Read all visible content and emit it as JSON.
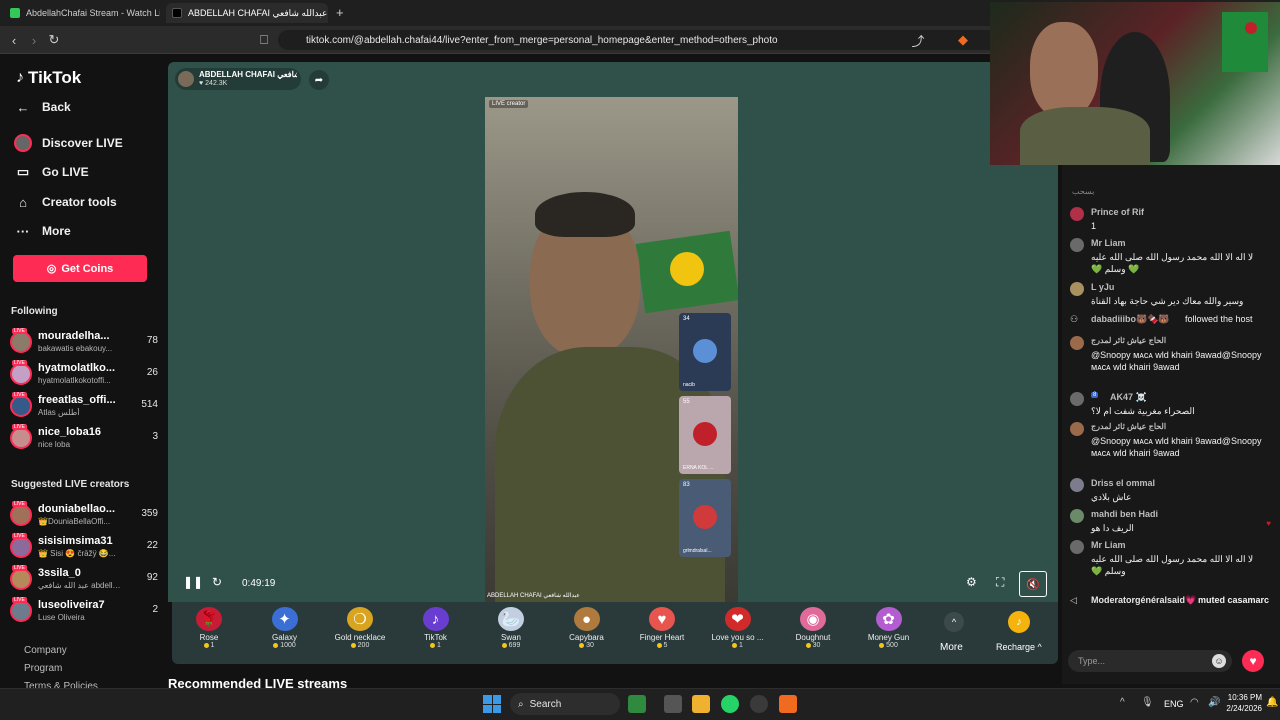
{
  "browser": {
    "tabs": [
      {
        "title": "AbdellahChafai Stream - Watch Live o"
      },
      {
        "title": "ABDELLAH CHAFAI عبدالله شافعي"
      }
    ],
    "new_tab": "+",
    "url": "tiktok.com/@abdellah.chafai44/live?enter_from_merge=personal_homepage&enter_method=others_photo"
  },
  "sidebar": {
    "logo": "TikTok",
    "back": "Back",
    "nav": [
      {
        "label": "Discover LIVE",
        "icon": "avatar-icon"
      },
      {
        "label": "Go LIVE",
        "icon": "camera-icon"
      },
      {
        "label": "Creator tools",
        "icon": "home-icon"
      },
      {
        "label": "More",
        "icon": "dots-icon"
      }
    ],
    "get_coins": "Get Coins",
    "following_title": "Following",
    "following": [
      {
        "name": "mouradelha...",
        "sub": "bakawatis ebakouy...",
        "count": "78"
      },
      {
        "name": "hyatmolatlko...",
        "sub": "hyatmolatlkokotoffi...",
        "count": "26"
      },
      {
        "name": "freeatlas_offi...",
        "sub": "Atlas أطلس",
        "count": "514"
      },
      {
        "name": "nice_loba16",
        "sub": "nice loba",
        "count": "3"
      }
    ],
    "suggested_title": "Suggested LIVE creators",
    "suggested": [
      {
        "name": "douniabellao...",
        "sub": "👑DouniaBellaOffi...",
        "count": "359"
      },
      {
        "name": "sisisimsima31",
        "sub": "👑 Sisi 😍 črāžÿ 😂...",
        "count": "22"
      },
      {
        "name": "3ssila_0",
        "sub": "عبد الله شافعي abdellah...",
        "count": "92"
      },
      {
        "name": "luseoliveira7",
        "sub": "Luse Oliveira",
        "count": "2"
      }
    ],
    "footer": [
      "Company",
      "Program",
      "Terms & Policies"
    ],
    "live_tag": "LIVE"
  },
  "stream": {
    "host_name": "ABDELLAH CHAFAI عبدالله شافعي",
    "host_likes": "242.3K",
    "feed_tag": "LIVE creator",
    "watermark": "ABDELLAH CHAFAI عبدالله شافعي",
    "elapsed": "0:49:19",
    "guests": [
      {
        "num": "34",
        "name": "nacib"
      },
      {
        "num": "55",
        "name": "ERNA KOL ..."
      },
      {
        "num": "83",
        "name": "grlmdralsal..."
      }
    ]
  },
  "gifts": [
    {
      "name": "Rose",
      "price": "1",
      "icon": "🌹",
      "color": "#c61c35"
    },
    {
      "name": "Galaxy",
      "price": "1000",
      "icon": "✦",
      "color": "#3b6fd6"
    },
    {
      "name": "Gold necklace",
      "price": "200",
      "icon": "❍",
      "color": "#d9a520"
    },
    {
      "name": "TikTok",
      "price": "1",
      "icon": "♪",
      "color": "#6a3dd1"
    },
    {
      "name": "Swan",
      "price": "699",
      "icon": "🦢",
      "color": "#c3cfe0"
    },
    {
      "name": "Capybara",
      "price": "30",
      "icon": "●",
      "color": "#b07a3e"
    },
    {
      "name": "Finger Heart",
      "price": "5",
      "icon": "♥",
      "color": "#e8544e"
    },
    {
      "name": "Love you so ...",
      "price": "1",
      "icon": "❤",
      "color": "#d12a2a"
    },
    {
      "name": "Doughnut",
      "price": "30",
      "icon": "◉",
      "color": "#e06a9a"
    },
    {
      "name": "Money Gun",
      "price": "500",
      "icon": "✿",
      "color": "#b45dd0"
    }
  ],
  "gift_more": "More",
  "recharge": "Recharge",
  "recommended": "Recommended LIVE streams",
  "chat": {
    "top_snippet": "بسحب",
    "messages": [
      {
        "user": "Prince of Rif",
        "text": "1"
      },
      {
        "user": "Mr Liam",
        "text": "لا اله الا الله محمد رسول الله صلى الله عليه 💚 وسلم 💚"
      },
      {
        "user": "L yJu",
        "text": "وسير والله معاك دير شي حاجة بهاد القناة"
      },
      {
        "user": "dabadiiibo🐻🍫🐻",
        "text": "followed the host"
      },
      {
        "user": "الحاج عياش ثائر لمدرج",
        "text": "@Snoopy ᴍᴀᴄᴀ wld khairi 9awad@Snoopy ᴍᴀᴄᴀ wld khairi 9awad"
      },
      {
        "user": "AK47 ☠️",
        "text": "الصحراء مغربية شفت ام لا؟"
      },
      {
        "user": "الحاج عياش ثائر لمدرج",
        "text": "@Snoopy ᴍᴀᴄᴀ wld khairi 9awad@Snoopy ᴍᴀᴄᴀ wld khairi 9awad"
      },
      {
        "user": "Driss el ommal",
        "text": "عاش بلادي"
      },
      {
        "user": "mahdi ben Hadi",
        "text": "الريف دا هو"
      },
      {
        "user": "Mr Liam",
        "text": "لا اله الا الله محمد رسول الله صلى الله عليه وسلم 💚"
      },
      {
        "user": "Moderatorgénéralsaid💗",
        "text": "muted casamarc"
      }
    ],
    "badge_level": "8",
    "input_placeholder": "Type..."
  },
  "taskbar": {
    "search": "Search",
    "lang": "ENG",
    "time": "10:36 PM",
    "date": "2/24/2026"
  }
}
